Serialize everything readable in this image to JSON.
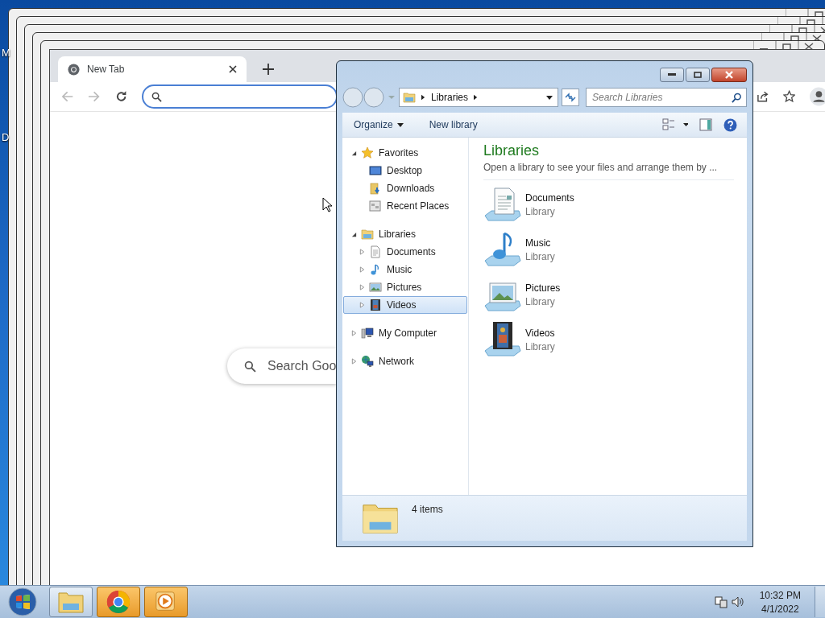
{
  "desktop": {
    "icon_labels": [
      "M",
      "D"
    ]
  },
  "browser": {
    "tab": {
      "title": "New Tab"
    },
    "search_box": {
      "placeholder": "Search Goo"
    }
  },
  "explorer": {
    "address": {
      "crumbs": [
        "Libraries"
      ]
    },
    "search": {
      "placeholder": "Search Libraries"
    },
    "toolbar": [
      {
        "label": "Organize",
        "kind": "menu"
      },
      {
        "label": "New library",
        "kind": "button"
      }
    ],
    "nav": [
      {
        "label": "Favorites",
        "kind": "star",
        "expanded": true,
        "selected": false,
        "children": [
          {
            "label": "Desktop",
            "kind": "desktop",
            "selected": false
          },
          {
            "label": "Downloads",
            "kind": "downloads",
            "selected": false
          },
          {
            "label": "Recent Places",
            "kind": "recent",
            "selected": false
          }
        ]
      },
      {
        "label": "Libraries",
        "kind": "libraries",
        "expanded": true,
        "selected": false,
        "children": [
          {
            "label": "Documents",
            "kind": "documents",
            "expanded": false,
            "selected": false
          },
          {
            "label": "Music",
            "kind": "music",
            "expanded": false,
            "selected": false
          },
          {
            "label": "Pictures",
            "kind": "pictures",
            "expanded": false,
            "selected": false
          },
          {
            "label": "Videos",
            "kind": "videos",
            "expanded": false,
            "selected": true
          }
        ]
      },
      {
        "label": "My Computer",
        "kind": "computer",
        "expanded": false,
        "selected": false
      },
      {
        "label": "Network",
        "kind": "network",
        "expanded": false,
        "selected": false
      }
    ],
    "content": {
      "title": "Libraries",
      "description": "Open a library to see your files and arrange them by ...",
      "items": [
        {
          "name": "Documents",
          "type": "Library",
          "kind": "documents"
        },
        {
          "name": "Music",
          "type": "Library",
          "kind": "music"
        },
        {
          "name": "Pictures",
          "type": "Library",
          "kind": "pictures"
        },
        {
          "name": "Videos",
          "type": "Library",
          "kind": "videos"
        }
      ]
    },
    "status": "4 items"
  },
  "taskbar": {
    "buttons": [
      {
        "kind": "explorer",
        "flashing": false
      },
      {
        "kind": "chrome",
        "flashing": true
      },
      {
        "kind": "media",
        "flashing": true
      }
    ],
    "time": "10:32 PM",
    "date": "4/1/2022"
  }
}
